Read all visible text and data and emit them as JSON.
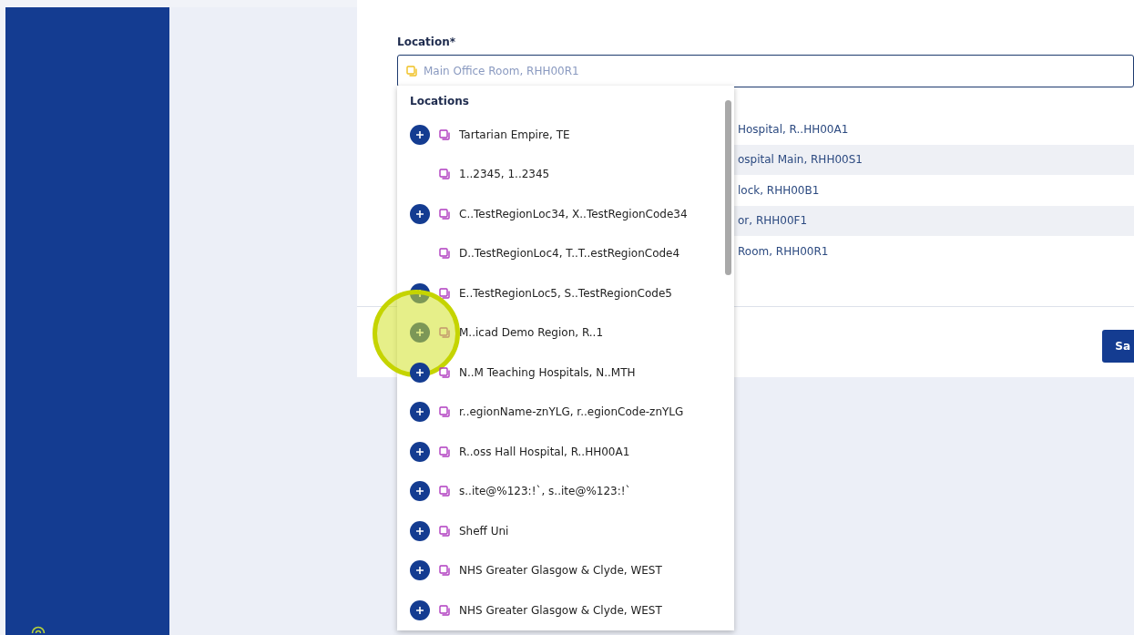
{
  "sidebar": {
    "help_icon": true
  },
  "form": {
    "label": "Location*",
    "field": {
      "placeholder": "Main Office Room, RHH00R1"
    }
  },
  "background_rows": [
    {
      "text": "Hospital, R..HH00A1",
      "shaded": false
    },
    {
      "text": "ospital Main, RHH00S1",
      "shaded": true
    },
    {
      "text": "lock, RHH00B1",
      "shaded": false
    },
    {
      "text": "or, RHH00F1",
      "shaded": true
    },
    {
      "text": "Room, RHH00R1",
      "shaded": false
    }
  ],
  "save_button": {
    "label": "Sa"
  },
  "dropdown": {
    "heading": "Locations",
    "items": [
      {
        "label": "Tartarian Empire, TE",
        "expandable": true,
        "highlighted": false
      },
      {
        "label": "1..2345, 1..2345",
        "expandable": false,
        "highlighted": false
      },
      {
        "label": "C..TestRegionLoc34, X..TestRegionCode34",
        "expandable": true,
        "highlighted": false
      },
      {
        "label": "D..TestRegionLoc4, T..T..estRegionCode4",
        "expandable": false,
        "highlighted": false
      },
      {
        "label": "E..TestRegionLoc5, S..TestRegionCode5",
        "expandable": true,
        "highlighted": false
      },
      {
        "label": "M..icad Demo Region, R..1",
        "expandable": true,
        "highlighted": true
      },
      {
        "label": "N..M Teaching Hospitals, N..MTH",
        "expandable": true,
        "highlighted": false
      },
      {
        "label": "r..egionName-znYLG, r..egionCode-znYLG",
        "expandable": true,
        "highlighted": false
      },
      {
        "label": "R..oss Hall Hospital, R..HH00A1",
        "expandable": true,
        "highlighted": false
      },
      {
        "label": "s..ite@%123:!`, s..ite@%123:!`",
        "expandable": true,
        "highlighted": false
      },
      {
        "label": "Sheff Uni",
        "expandable": true,
        "highlighted": false
      },
      {
        "label": "NHS Greater Glasgow & Clyde, WEST",
        "expandable": true,
        "highlighted": false
      },
      {
        "label": "NHS Greater Glasgow & Clyde, WEST",
        "expandable": true,
        "highlighted": false
      }
    ]
  }
}
